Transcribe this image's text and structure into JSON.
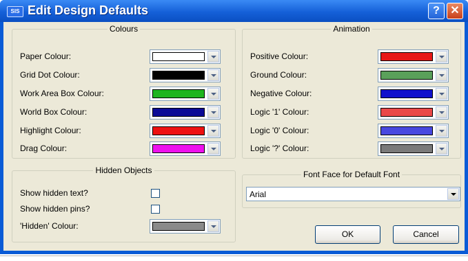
{
  "window": {
    "title": "Edit Design Defaults",
    "app_icon_text": "SIS",
    "help_glyph": "?",
    "close_glyph": "✕"
  },
  "colours": {
    "legend": "Colours",
    "items": [
      {
        "label": "Paper Colour:",
        "color": "#ffffff"
      },
      {
        "label": "Grid Dot Colour:",
        "color": "#000000"
      },
      {
        "label": "Work Area Box Colour:",
        "color": "#1fb51f"
      },
      {
        "label": "World Box Colour:",
        "color": "#0a0a96"
      },
      {
        "label": "Highlight Colour:",
        "color": "#ee1111"
      },
      {
        "label": "Drag Colour:",
        "color": "#ee11ee"
      }
    ]
  },
  "animation": {
    "legend": "Animation",
    "items": [
      {
        "label": "Positive Colour:",
        "color": "#e81818"
      },
      {
        "label": "Ground Colour:",
        "color": "#5aa05a"
      },
      {
        "label": "Negative Colour:",
        "color": "#1010cc"
      },
      {
        "label": "Logic '1' Colour:",
        "color": "#ea4848"
      },
      {
        "label": "Logic '0' Colour:",
        "color": "#4848e0"
      },
      {
        "label": "Logic '?' Colour:",
        "color": "#7a7a7a"
      }
    ]
  },
  "hidden_objects": {
    "legend": "Hidden Objects",
    "show_hidden_text_label": "Show hidden text?",
    "show_hidden_text_checked": false,
    "show_hidden_pins_label": "Show hidden pins?",
    "show_hidden_pins_checked": false,
    "hidden_colour_label": "'Hidden' Colour:",
    "hidden_colour": "#8a8a8a"
  },
  "font_face": {
    "legend": "Font Face for Default Font",
    "value": "Arial"
  },
  "buttons": {
    "ok": "OK",
    "cancel": "Cancel"
  }
}
